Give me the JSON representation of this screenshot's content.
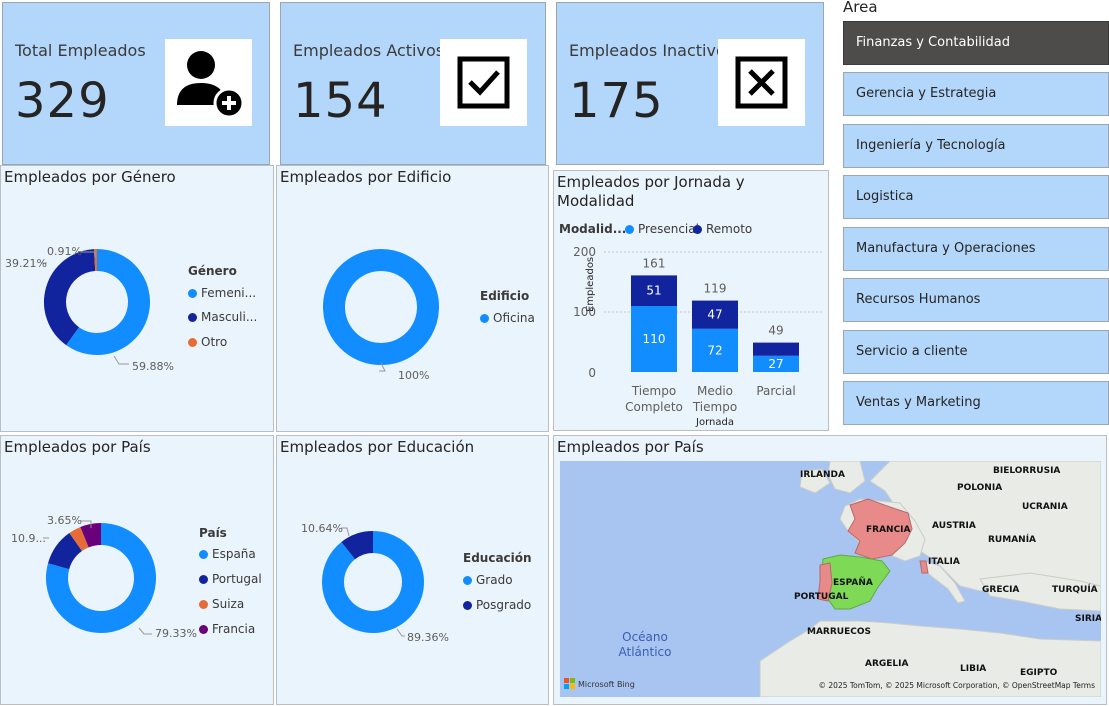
{
  "kpis": [
    {
      "title": "Total Empleados",
      "value": "329",
      "icon": "add-user-icon"
    },
    {
      "title": "Empleados Activos",
      "value": "154",
      "icon": "checkbox-checked-icon"
    },
    {
      "title": "Empleados Inactivos",
      "value": "175",
      "icon": "checkbox-x-icon"
    }
  ],
  "area": {
    "label": "Area",
    "items": [
      "Finanzas y Contabilidad",
      "Gerencia y Estrategia",
      "Ingeniería y Tecnología",
      "Logistica",
      "Manufactura y Operaciones",
      "Recursos Humanos",
      "Servicio a cliente",
      "Ventas y Marketing"
    ],
    "selected_index": 0
  },
  "genero": {
    "title": "Empleados por Género",
    "legend_title": "Género",
    "legend": [
      "Femeni...",
      "Masculi...",
      "Otro"
    ],
    "labels": [
      "59.88%",
      "39.21%",
      "0.91%"
    ]
  },
  "edificio": {
    "title": "Empleados por Edificio",
    "legend_title": "Edificio",
    "legend": [
      "Oficina"
    ],
    "labels": [
      "100%"
    ]
  },
  "jornada": {
    "title": "Empleados por Jornada y Modalidad",
    "legend_title": "Modalid...",
    "legend": [
      "Presencial",
      "Remoto"
    ],
    "y_title": "Empleados",
    "y_ticks": [
      "200",
      "100",
      "0"
    ],
    "x_title": "Jornada",
    "categories": [
      "Tiempo Completo",
      "Medio Tiempo",
      "Parcial"
    ],
    "totals": [
      "161",
      "119",
      "49"
    ],
    "presencial_labels": [
      "110",
      "72",
      "27"
    ],
    "remoto_labels": [
      "51",
      "47",
      ""
    ]
  },
  "pais": {
    "title": "Empleados por País",
    "legend_title": "País",
    "legend": [
      "España",
      "Portugal",
      "Suiza",
      "Francia"
    ],
    "labels": [
      "79.33%",
      "10.9...",
      "3.65%"
    ]
  },
  "educacion": {
    "title": "Empleados por Educación",
    "legend_title": "Educación",
    "legend": [
      "Grado",
      "Posgrado"
    ],
    "labels": [
      "89.36%",
      "10.64%"
    ]
  },
  "mapa": {
    "title": "Empleados por País",
    "countries": [
      "IRLANDA",
      "BIELORRUSIA",
      "POLONIA",
      "UCRANIA",
      "FRANCIA",
      "AUSTRIA",
      "RUMANÍA",
      "ITALIA",
      "ESPAÑA",
      "PORTUGAL",
      "GRECIA",
      "TURQUÍA",
      "SIRIA",
      "MARRUECOS",
      "ARGELIA",
      "LIBIA",
      "EGIPTO"
    ],
    "ocean": [
      "Océano",
      "Atlántico"
    ],
    "bing": "Microsoft Bing",
    "copyright": "© 2025 TomTom, © 2025 Microsoft Corporation, © OpenStreetMap  Terms"
  },
  "colors": {
    "light_blue": "#118dff",
    "dark_blue": "#12239e",
    "orange": "#e66c37",
    "purple": "#6b007b",
    "kpi_bg": "#b3d7fb",
    "panel_bg": "#eaf4fd",
    "land": "#e8ebe6",
    "water": "#a8c4f0",
    "spain": "#7ed957",
    "france": "#e88a8a"
  },
  "chart_data": [
    {
      "type": "pie",
      "title": "Empleados por Género",
      "categories": [
        "Femeni...",
        "Masculi...",
        "Otro"
      ],
      "values": [
        59.88,
        39.21,
        0.91
      ]
    },
    {
      "type": "pie",
      "title": "Empleados por Edificio",
      "categories": [
        "Oficina"
      ],
      "values": [
        100
      ]
    },
    {
      "type": "bar",
      "title": "Empleados por Jornada y Modalidad",
      "categories": [
        "Tiempo Completo",
        "Medio Tiempo",
        "Parcial"
      ],
      "series": [
        {
          "name": "Presencial",
          "values": [
            110,
            72,
            27
          ]
        },
        {
          "name": "Remoto",
          "values": [
            51,
            47,
            22
          ]
        }
      ],
      "totals": [
        161,
        119,
        49
      ],
      "xlabel": "Jornada",
      "ylabel": "Empleados",
      "ylim": [
        0,
        200
      ],
      "stacked": true
    },
    {
      "type": "pie",
      "title": "Empleados por País",
      "categories": [
        "España",
        "Portugal",
        "Suiza",
        "Francia"
      ],
      "values": [
        79.33,
        10.9,
        3.65,
        6.12
      ]
    },
    {
      "type": "pie",
      "title": "Empleados por Educación",
      "categories": [
        "Grado",
        "Posgrado"
      ],
      "values": [
        89.36,
        10.64
      ]
    }
  ]
}
